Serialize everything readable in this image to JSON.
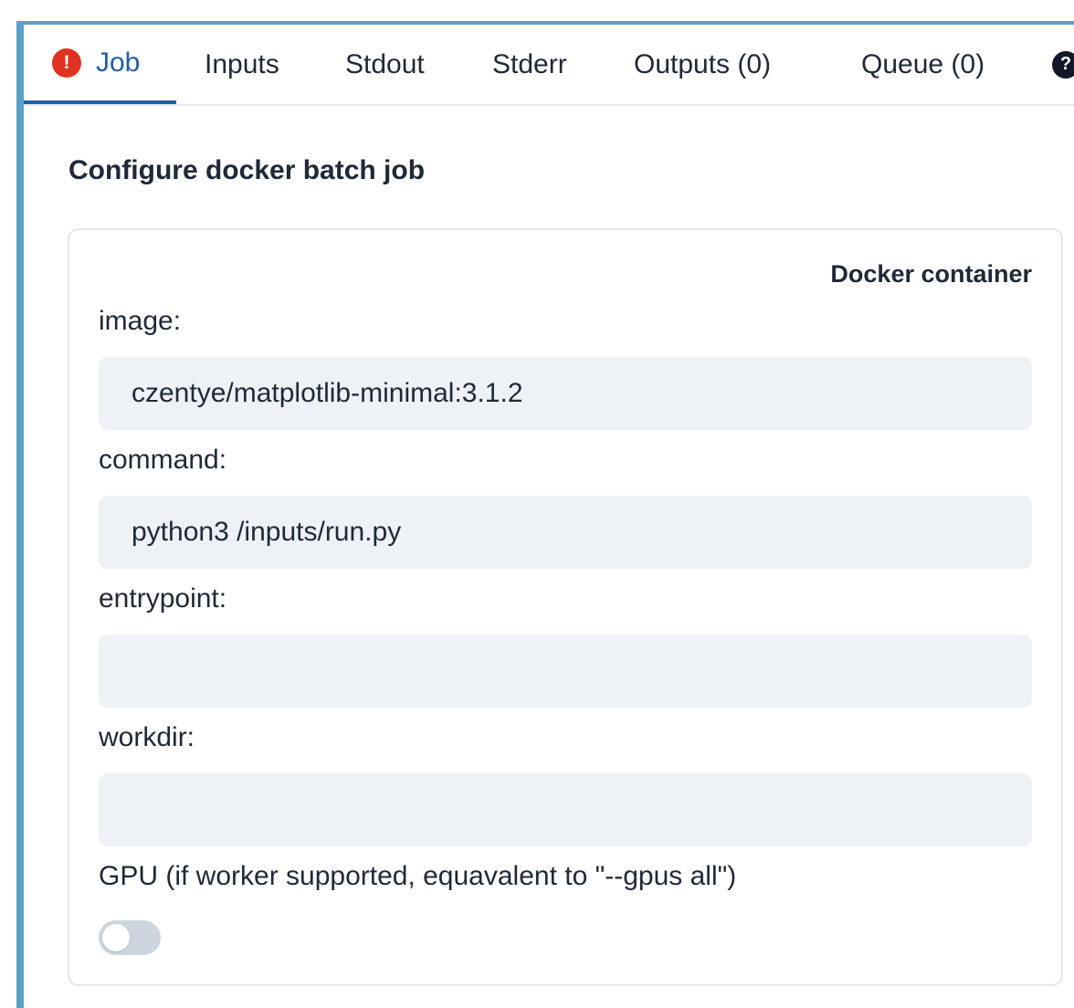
{
  "tabs": {
    "job": "Job",
    "inputs": "Inputs",
    "stdout": "Stdout",
    "stderr": "Stderr",
    "outputs": "Outputs (0)",
    "queue": "Queue (0)",
    "help_icon": "question-icon",
    "alert_icon": "exclamation-icon",
    "active": "Job"
  },
  "section": {
    "title": "Configure docker batch job"
  },
  "card": {
    "heading": "Docker container",
    "image_label": "image:",
    "image_value": "czentye/matplotlib-minimal:3.1.2",
    "command_label": "command:",
    "command_value": "python3 /inputs/run.py",
    "entrypoint_label": "entrypoint:",
    "entrypoint_value": "",
    "workdir_label": "workdir:",
    "workdir_value": "",
    "gpu_label": "GPU (if worker supported, equavalent to \"--gpus all\")",
    "gpu_enabled": false
  },
  "colors": {
    "accent": "#5aa0c8",
    "active_tab": "#1f5fa6",
    "alert": "#e03221",
    "input_bg": "#eef1f6",
    "toggle_off": "#cdd5df"
  }
}
